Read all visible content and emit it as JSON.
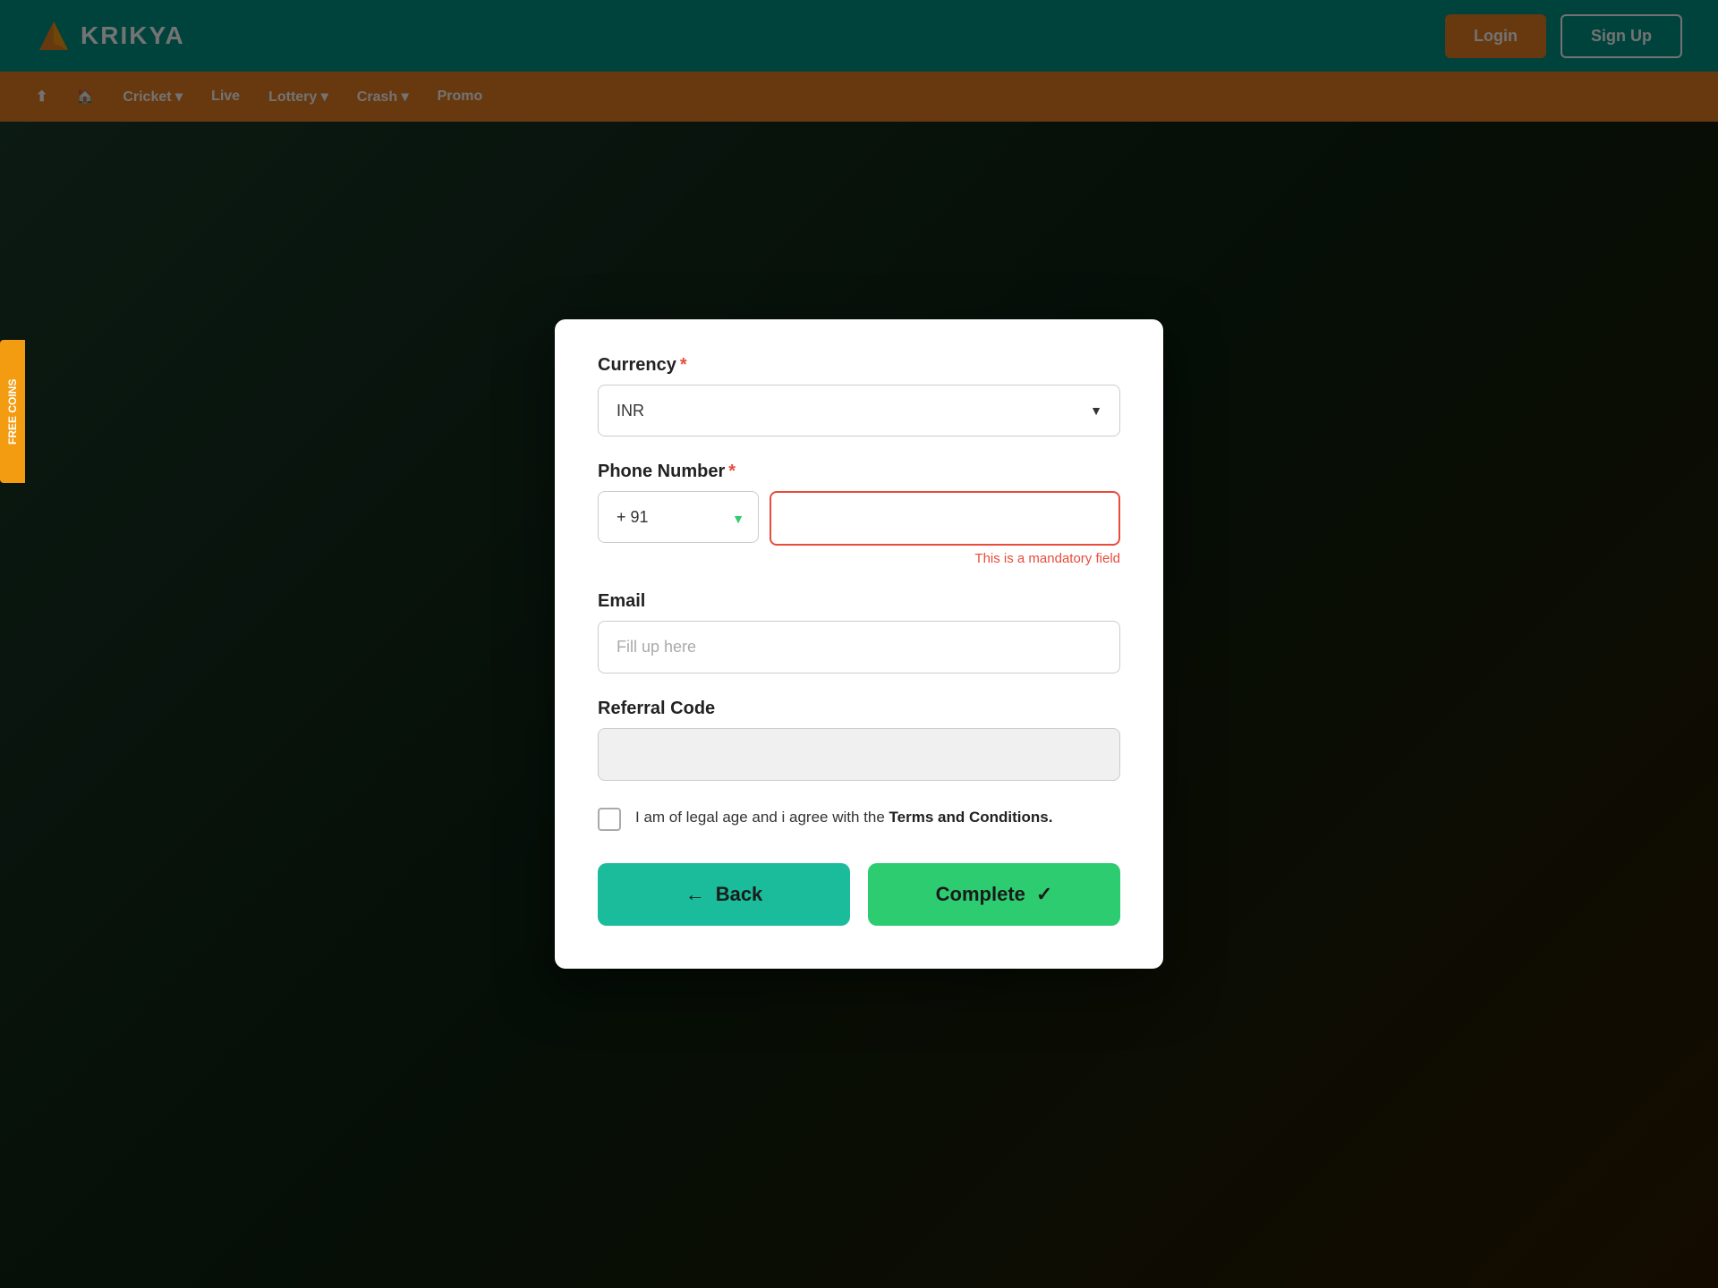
{
  "header": {
    "logo_text": "KRIKYA",
    "login_label": "Login",
    "signup_label": "Sign Up"
  },
  "nav": {
    "items": [
      {
        "label": "Cricket ▾"
      },
      {
        "label": "Live"
      },
      {
        "label": "Lottery ▾"
      },
      {
        "label": "Crash ▾"
      },
      {
        "label": "Promo"
      }
    ]
  },
  "sidebar": {
    "free_coins_label": "FREE COINS"
  },
  "modal": {
    "currency_label": "Currency",
    "currency_required": "*",
    "currency_value": "INR",
    "phone_label": "Phone Number",
    "phone_required": "*",
    "country_code": "+ 91",
    "phone_placeholder": "",
    "mandatory_error": "This is a mandatory field",
    "email_label": "Email",
    "email_placeholder": "Fill up here",
    "referral_label": "Referral Code",
    "referral_value": "",
    "terms_text_before": "I am of legal age and i agree with the ",
    "terms_link": "Terms and Conditions.",
    "back_label": "← Back",
    "complete_label": "Complete ✓",
    "back_arrow": "←",
    "complete_check": "✓"
  }
}
